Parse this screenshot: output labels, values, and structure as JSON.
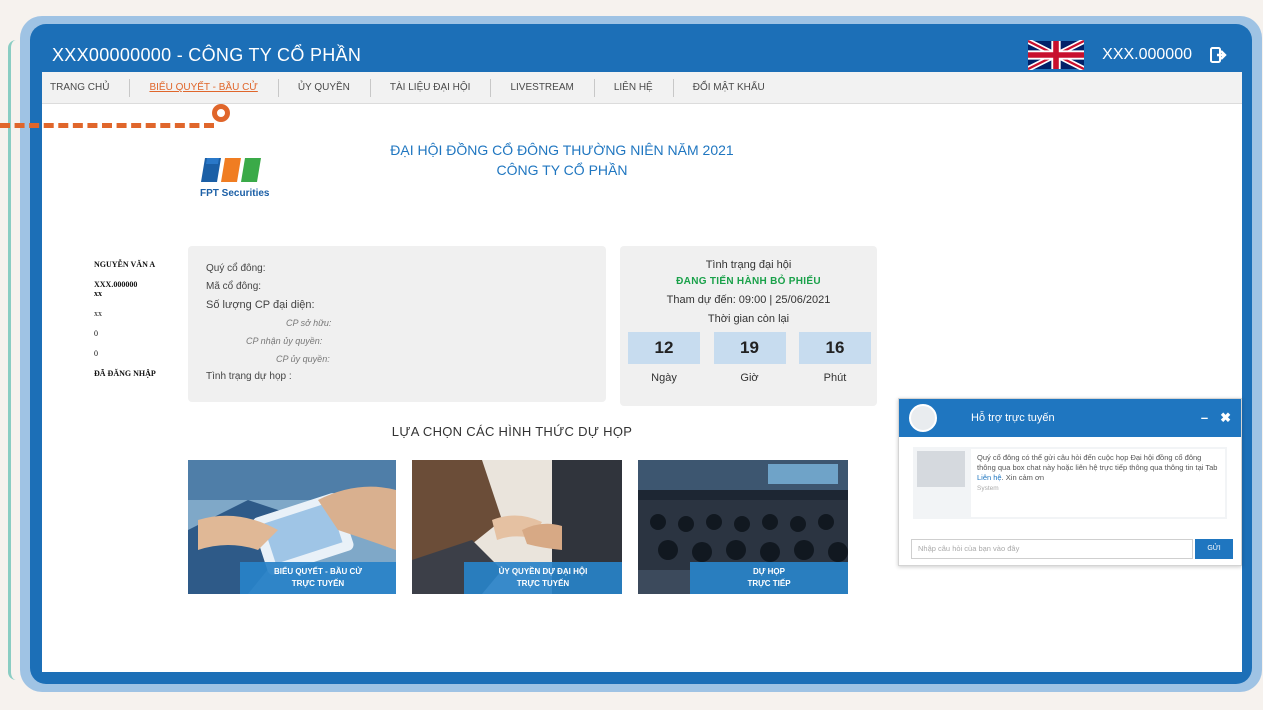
{
  "window": {
    "title": "XXX00000000 - CÔNG TY CỔ PHẦN",
    "account": "XXX.000000",
    "icons": {
      "language": "uk-flag-icon",
      "logout": "logout-icon"
    }
  },
  "nav": {
    "items": [
      {
        "label": "TRANG CHỦ",
        "active": false
      },
      {
        "label": "BIỂU QUYẾT - BẦU CỬ",
        "active": true
      },
      {
        "label": "ỦY QUYỀN",
        "active": false
      },
      {
        "label": "TÀI LIỆU ĐẠI HỘI",
        "active": false
      },
      {
        "label": "LIVESTREAM",
        "active": false
      },
      {
        "label": "LIÊN HỆ",
        "active": false
      },
      {
        "label": "ĐỔI MẬT KHẨU",
        "active": false
      }
    ]
  },
  "heading": {
    "line1": "ĐẠI HỘI ĐỒNG CỔ ĐÔNG THƯỜNG NIÊN NĂM 2021",
    "line2": "CÔNG TY CỔ PHẦN"
  },
  "logo": {
    "text": "FPT Securities"
  },
  "holder": {
    "name": "NGUYỄN VĂN A",
    "code": "XXX.000000",
    "code_suffix": "xx",
    "shares": "xx",
    "owned": "0",
    "delegated": "0",
    "status": "ĐÃ ĐĂNG NHẬP"
  },
  "info": {
    "shareholder_label": "Quý cổ đông:",
    "code_label": "Mã cổ đông:",
    "shares_label": "Số lượng CP đại diện:",
    "owned_label": "CP sở hữu:",
    "received_label": "CP nhận ủy quyền:",
    "delegated_label": "CP ủy quyền:",
    "attend_label": "Tình trạng dự họp :"
  },
  "status": {
    "title": "Tình trạng đại hội",
    "state": "ĐANG TIẾN HÀNH BỎ PHIẾU",
    "deadline": "Tham dự đến: 09:00 | 25/06/2021",
    "remaining_label": "Thời gian còn lại",
    "countdown": [
      {
        "value": "12",
        "label": "Ngày"
      },
      {
        "value": "19",
        "label": "Giờ"
      },
      {
        "value": "16",
        "label": "Phút"
      }
    ],
    "colors": {
      "state": "#1aa14a",
      "box": "#c7dcef"
    }
  },
  "choose": {
    "title": "LỰA CHỌN CÁC HÌNH THỨC DỰ HỌP",
    "cards": [
      {
        "line1": "BIỂU QUYẾT - BẦU CỬ",
        "line2": "TRỰC TUYẾN"
      },
      {
        "line1": "ỦY QUYỀN DỰ ĐẠI HỘI",
        "line2": "TRỰC TUYẾN"
      },
      {
        "line1": "DỰ HỌP",
        "line2": "TRỰC TIẾP"
      }
    ]
  },
  "chat": {
    "title": "Hỗ trợ trực tuyến",
    "minimize": "–",
    "close": "✖",
    "message_pre": "Quý cổ đông có thể gửi câu hỏi đến cuộc họp Đại hội đồng cổ đông thông qua box chat này hoặc liên hệ trực tiếp thông qua thông tin tại Tab ",
    "message_link": "Liên hệ",
    "message_post": ". Xin cảm ơn",
    "sender": "System",
    "input_placeholder": "Nhập câu hỏi của bạn vào đây",
    "send_label": "GỬI"
  },
  "colors": {
    "primary": "#1f76c0",
    "frame": "#1c6fb7",
    "accent": "#e0662b"
  }
}
